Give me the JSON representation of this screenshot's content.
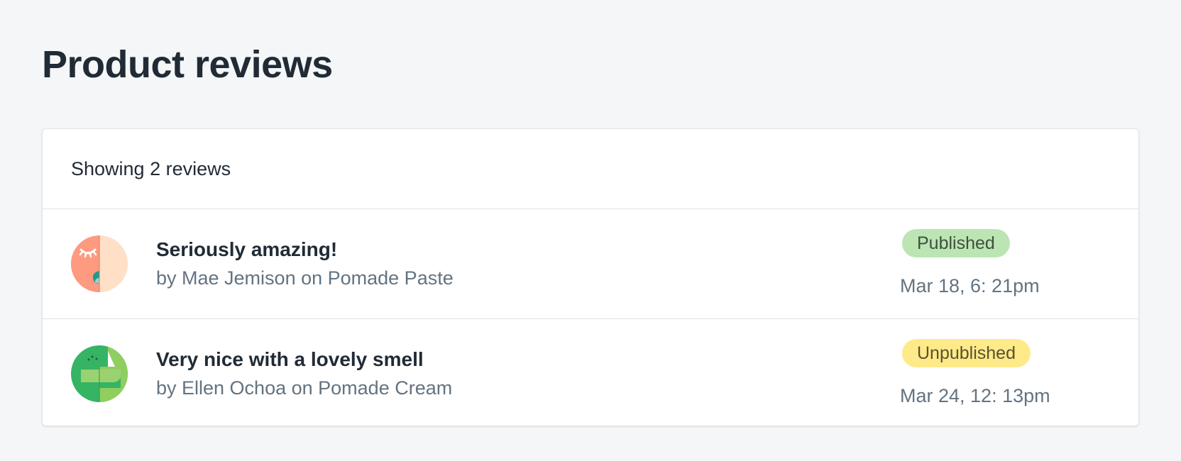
{
  "page": {
    "title": "Product reviews"
  },
  "reviews_card": {
    "summary": "Showing 2 reviews",
    "items": [
      {
        "title": "Seriously amazing!",
        "meta": "by Mae Jemison on Pomade Paste",
        "status": "Published",
        "date": "Mar 18, 6: 21pm",
        "avatar_icon": "avatar-illustration-orange"
      },
      {
        "title": "Very nice with a lovely smell",
        "meta": "by Ellen Ochoa on Pomade Cream",
        "status": "Unpublished",
        "date": "Mar 24, 12: 13pm",
        "avatar_icon": "avatar-illustration-green"
      }
    ]
  },
  "colors": {
    "background": "#f4f6f8",
    "published_badge": "#bbe5b3",
    "unpublished_badge": "#ffea8a",
    "text_primary": "#212b36",
    "text_secondary": "#637381"
  }
}
